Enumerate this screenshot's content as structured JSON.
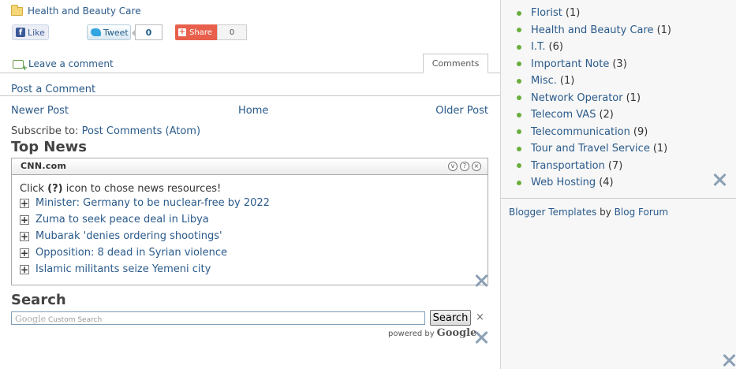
{
  "post": {
    "label_link": "Health and Beauty Care",
    "fb_like_label": "Like",
    "tweet_label": "Tweet",
    "tweet_count": "0",
    "share_label": "Share",
    "share_count": "0",
    "leave_comment": "Leave a comment",
    "comments_tab": "Comments",
    "post_a_comment": "Post a Comment"
  },
  "nav": {
    "newer": "Newer Post",
    "home": "Home",
    "older": "Older Post"
  },
  "subscribe": {
    "prefix": "Subscribe to:",
    "link": "Post Comments (Atom)"
  },
  "top_news": {
    "title": "Top News",
    "source": "CNN.com",
    "help_prefix": "Click",
    "help_icon": "(?)",
    "help_suffix": "icon to chose news resources!",
    "items": [
      "Minister: Germany to be nuclear-free by 2022",
      "Zuma to seek peace deal in Libya",
      "Mubarak 'denies ordering shootings'",
      "Opposition: 8 dead in Syrian violence",
      "Islamic militants seize Yemeni city"
    ]
  },
  "search": {
    "title": "Search",
    "placeholder_logo": "Google",
    "placeholder_text": "Custom Search",
    "button": "Search",
    "clear": "×",
    "powered_by": "powered by",
    "powered_logo": "Google"
  },
  "sidebar": {
    "labels": [
      {
        "name": "Florist",
        "count": "(1)"
      },
      {
        "name": "Health and Beauty Care",
        "count": "(1)"
      },
      {
        "name": "I.T.",
        "count": "(6)"
      },
      {
        "name": "Important Note",
        "count": "(3)"
      },
      {
        "name": "Misc.",
        "count": "(1)"
      },
      {
        "name": "Network Operator",
        "count": "(1)"
      },
      {
        "name": "Telecom VAS",
        "count": "(2)"
      },
      {
        "name": "Telecommunication",
        "count": "(9)"
      },
      {
        "name": "Tour and Travel Service",
        "count": "(1)"
      },
      {
        "name": "Transportation",
        "count": "(7)"
      },
      {
        "name": "Web Hosting",
        "count": "(4)"
      }
    ],
    "credits_link1": "Blogger Templates",
    "credits_by": "by",
    "credits_link2": "Blog Forum"
  },
  "colors": {
    "link": "#2a5a8a",
    "bullet": "#6aae3c",
    "share": "#e8604c"
  }
}
